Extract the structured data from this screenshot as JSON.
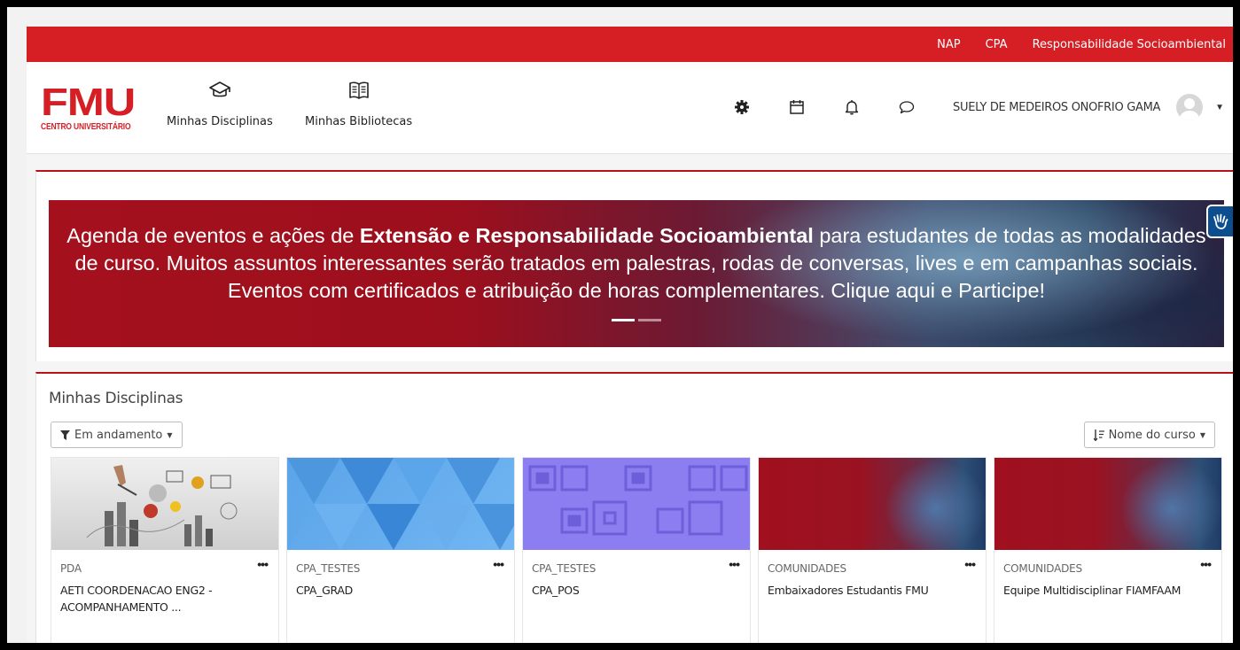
{
  "topbar": {
    "links": [
      "NAP",
      "CPA",
      "Responsabilidade Socioambiental"
    ]
  },
  "navbar": {
    "logo_main": "FMU",
    "logo_sub": "CENTRO UNIVERSITÁRIO",
    "items": [
      {
        "label": "Minhas Disciplinas",
        "icon": "graduation-cap-icon"
      },
      {
        "label": "Minhas Bibliotecas",
        "icon": "book-icon"
      }
    ],
    "user_name": "SUELY DE MEDEIROS ONOFRIO GAMA"
  },
  "banner": {
    "text_before": "Agenda de eventos e ações de ",
    "text_bold": "Extensão e Responsabilidade Socioambiental",
    "text_after": " para estudantes de todas as modalidades de curso. Muitos assuntos interessantes serão tratados em palestras, rodas de conversas, lives e em campanhas sociais. Eventos com certificados e atribuição de horas complementares. Clique aqui e Participe!"
  },
  "courses_section": {
    "title": "Minhas Disciplinas",
    "filter_label": "Em andamento",
    "sort_label": "Nome do curso",
    "courses": [
      {
        "category": "PDA",
        "name": "AETI COORDENACAO ENG2 - ACOMPANHAMENTO ...",
        "image": "sketch"
      },
      {
        "category": "CPA_TESTES",
        "name": "CPA_GRAD",
        "image": "blue-triangles"
      },
      {
        "category": "CPA_TESTES",
        "name": "CPA_POS",
        "image": "purple-squares"
      },
      {
        "category": "COMUNIDADES",
        "name": "Embaixadores Estudantis FMU",
        "image": "red-gradient"
      },
      {
        "category": "COMUNIDADES",
        "name": "Equipe Multidisciplinar FIAMFAAM",
        "image": "red-gradient"
      }
    ]
  },
  "colors": {
    "brand_red": "#d51f24",
    "accessibility_blue": "#0d4e8f"
  }
}
